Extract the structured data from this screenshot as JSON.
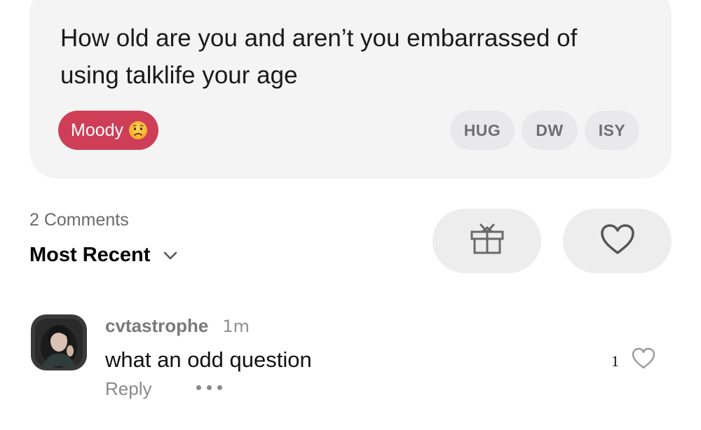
{
  "post": {
    "text": "How old are you and aren’t you embarrassed of using talklife your age",
    "mood": {
      "label": "Moody",
      "emoji": "worried-face-icon",
      "color": "#cf3e57"
    },
    "reactions": [
      {
        "label": "HUG"
      },
      {
        "label": "DW"
      },
      {
        "label": "ISY"
      }
    ]
  },
  "comments_header": {
    "count_label": "2 Comments",
    "sort_label": "Most Recent",
    "sort_icon": "chevron-down-icon"
  },
  "actions": {
    "gift_icon": "gift-icon",
    "like_icon": "heart-icon"
  },
  "comments": [
    {
      "username": "cvtastrophe",
      "time": "1m",
      "text": "what an odd question",
      "reply_label": "Reply",
      "likes": "1",
      "more_icon": "more-dots-icon",
      "like_icon": "heart-icon"
    }
  ],
  "colors": {
    "card_bg": "#f4f4f5",
    "chip_bg": "#e9e9eb",
    "accent": "#cf3e57"
  }
}
